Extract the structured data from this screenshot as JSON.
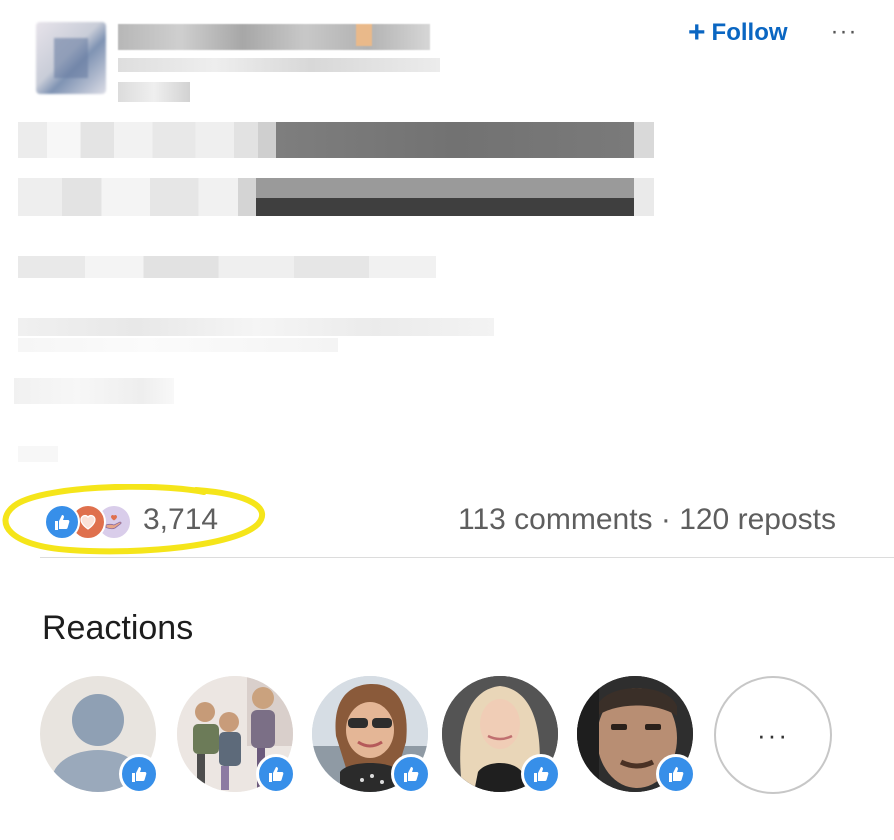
{
  "header": {
    "follow_plus": "+",
    "follow_label": "Follow",
    "more_label": "···"
  },
  "social": {
    "reactions_count": "3,714",
    "comments_reposts": "113 comments · 120 reposts"
  },
  "reactions_section": {
    "title": "Reactions",
    "more_label": "···"
  },
  "colors": {
    "accent_blue": "#0a66c2",
    "like_blue": "#378fe9",
    "love_red": "#df704d",
    "highlight_yellow": "#f5e51a"
  },
  "icons": [
    "like-reaction-icon",
    "love-reaction-icon",
    "support-reaction-icon"
  ]
}
